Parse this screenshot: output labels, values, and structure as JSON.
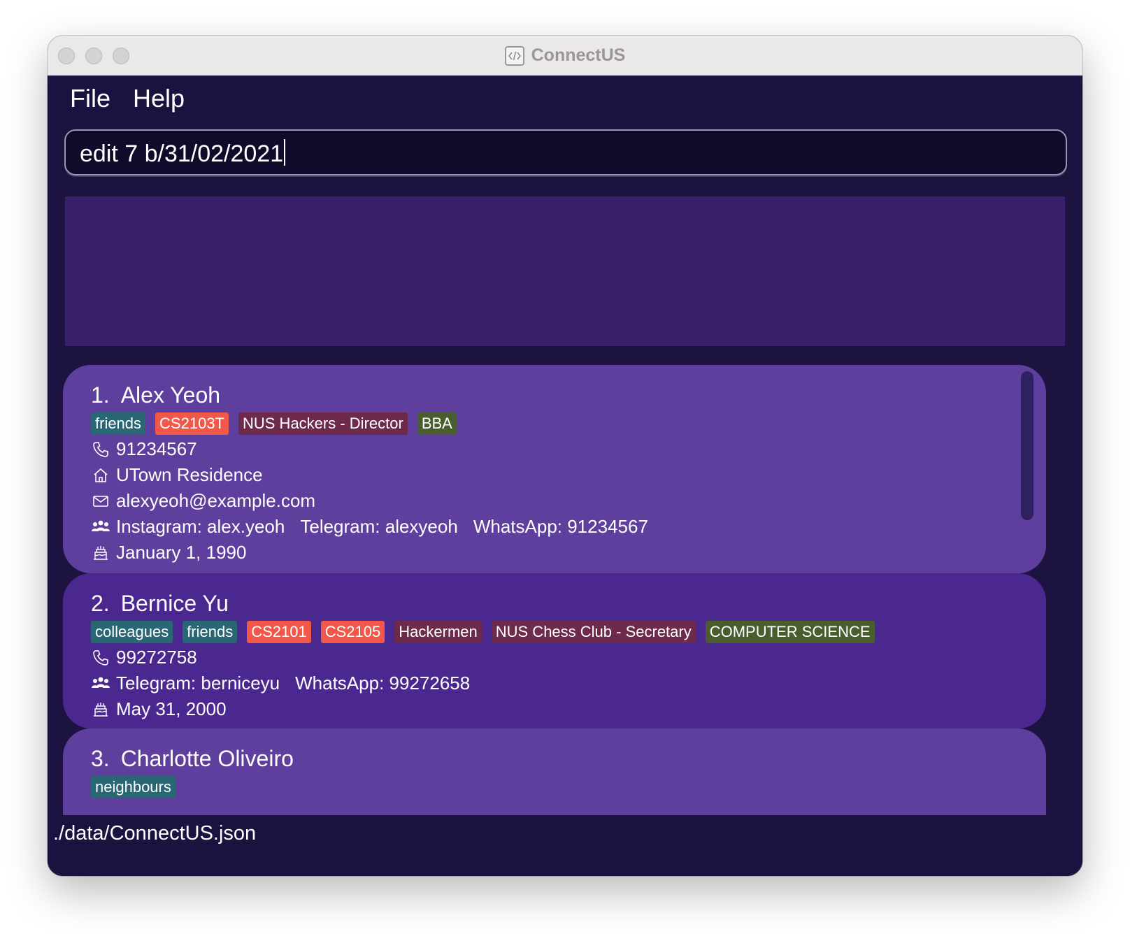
{
  "window": {
    "title": "ConnectUS"
  },
  "menu": {
    "file": "File",
    "help": "Help"
  },
  "command": {
    "value": "edit 7 b/31/02/2021"
  },
  "result": {
    "text": ""
  },
  "persons": [
    {
      "index": "1.",
      "name": "Alex Yeoh",
      "tags": [
        {
          "label": "friends",
          "color": "#2a6775"
        },
        {
          "label": "CS2103T",
          "color": "#f2584a"
        },
        {
          "label": "NUS Hackers - Director",
          "color": "#6e2a4b"
        },
        {
          "label": "BBA",
          "color": "#4a5d2e"
        }
      ],
      "phone": "91234567",
      "address": "UTown Residence",
      "email": "alexyeoh@example.com",
      "socials": [
        "Instagram: alex.yeoh",
        "Telegram: alexyeoh",
        "WhatsApp: 91234567"
      ],
      "birthday": "January 1, 1990"
    },
    {
      "index": "2.",
      "name": "Bernice Yu",
      "tags": [
        {
          "label": "colleagues",
          "color": "#2a6775"
        },
        {
          "label": "friends",
          "color": "#2a6775"
        },
        {
          "label": "CS2101",
          "color": "#f2584a"
        },
        {
          "label": "CS2105",
          "color": "#f2584a"
        },
        {
          "label": "Hackermen",
          "color": "#6e2a4b"
        },
        {
          "label": "NUS Chess Club - Secretary",
          "color": "#6e2a4b"
        },
        {
          "label": "COMPUTER SCIENCE",
          "color": "#4a5d2e"
        }
      ],
      "phone": "99272758",
      "socials": [
        "Telegram: berniceyu",
        "WhatsApp: 99272658"
      ],
      "birthday": "May 31, 2000"
    },
    {
      "index": "3.",
      "name": "Charlotte Oliveiro",
      "tags": [
        {
          "label": "neighbours",
          "color": "#2a6775"
        }
      ]
    }
  ],
  "status": {
    "path": "./data/ConnectUS.json"
  }
}
